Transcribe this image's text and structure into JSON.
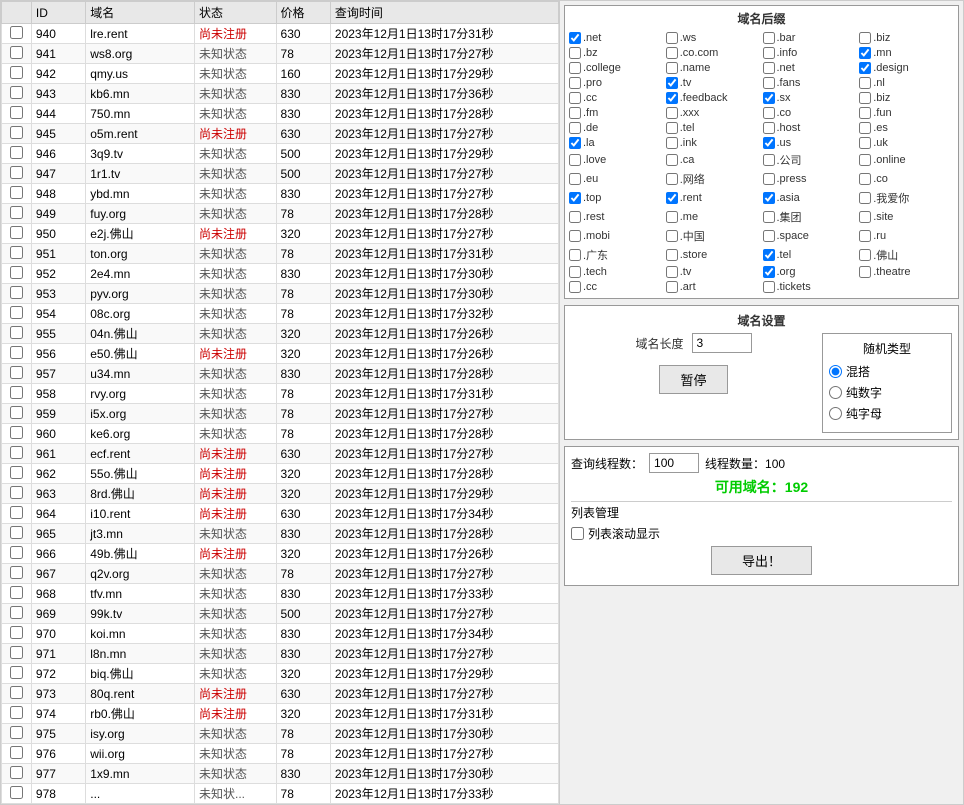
{
  "table": {
    "headers": [
      "",
      "ID",
      "域名",
      "状态",
      "价格",
      "查询时间"
    ],
    "rows": [
      {
        "id": "940",
        "domain": "lre.rent",
        "status": "尚未注册",
        "price": "630",
        "time": "2023年12月1日13时17分31秒"
      },
      {
        "id": "941",
        "domain": "ws8.org",
        "status": "未知状态",
        "price": "78",
        "time": "2023年12月1日13时17分27秒"
      },
      {
        "id": "942",
        "domain": "qmy.us",
        "status": "未知状态",
        "price": "160",
        "time": "2023年12月1日13时17分29秒"
      },
      {
        "id": "943",
        "domain": "kb6.mn",
        "status": "未知状态",
        "price": "830",
        "time": "2023年12月1日13时17分36秒"
      },
      {
        "id": "944",
        "domain": "750.mn",
        "status": "未知状态",
        "price": "830",
        "time": "2023年12月1日13时17分28秒"
      },
      {
        "id": "945",
        "domain": "o5m.rent",
        "status": "尚未注册",
        "price": "630",
        "time": "2023年12月1日13时17分27秒"
      },
      {
        "id": "946",
        "domain": "3q9.tv",
        "status": "未知状态",
        "price": "500",
        "time": "2023年12月1日13时17分29秒"
      },
      {
        "id": "947",
        "domain": "1r1.tv",
        "status": "未知状态",
        "price": "500",
        "time": "2023年12月1日13时17分27秒"
      },
      {
        "id": "948",
        "domain": "ybd.mn",
        "status": "未知状态",
        "price": "830",
        "time": "2023年12月1日13时17分27秒"
      },
      {
        "id": "949",
        "domain": "fuy.org",
        "status": "未知状态",
        "price": "78",
        "time": "2023年12月1日13时17分28秒"
      },
      {
        "id": "950",
        "domain": "e2j.佛山",
        "status": "尚未注册",
        "price": "320",
        "time": "2023年12月1日13时17分27秒"
      },
      {
        "id": "951",
        "domain": "ton.org",
        "status": "未知状态",
        "price": "78",
        "time": "2023年12月1日13时17分31秒"
      },
      {
        "id": "952",
        "domain": "2e4.mn",
        "status": "未知状态",
        "price": "830",
        "time": "2023年12月1日13时17分30秒"
      },
      {
        "id": "953",
        "domain": "pyv.org",
        "status": "未知状态",
        "price": "78",
        "time": "2023年12月1日13时17分30秒"
      },
      {
        "id": "954",
        "domain": "08c.org",
        "status": "未知状态",
        "price": "78",
        "time": "2023年12月1日13时17分32秒"
      },
      {
        "id": "955",
        "domain": "04n.佛山",
        "status": "未知状态",
        "price": "320",
        "time": "2023年12月1日13时17分26秒"
      },
      {
        "id": "956",
        "domain": "e50.佛山",
        "status": "尚未注册",
        "price": "320",
        "time": "2023年12月1日13时17分26秒"
      },
      {
        "id": "957",
        "domain": "u34.mn",
        "status": "未知状态",
        "price": "830",
        "time": "2023年12月1日13时17分28秒"
      },
      {
        "id": "958",
        "domain": "rvy.org",
        "status": "未知状态",
        "price": "78",
        "time": "2023年12月1日13时17分31秒"
      },
      {
        "id": "959",
        "domain": "i5x.org",
        "status": "未知状态",
        "price": "78",
        "time": "2023年12月1日13时17分27秒"
      },
      {
        "id": "960",
        "domain": "ke6.org",
        "status": "未知状态",
        "price": "78",
        "time": "2023年12月1日13时17分28秒"
      },
      {
        "id": "961",
        "domain": "ecf.rent",
        "status": "尚未注册",
        "price": "630",
        "time": "2023年12月1日13时17分27秒"
      },
      {
        "id": "962",
        "domain": "55o.佛山",
        "status": "尚未注册",
        "price": "320",
        "time": "2023年12月1日13时17分28秒"
      },
      {
        "id": "963",
        "domain": "8rd.佛山",
        "status": "尚未注册",
        "price": "320",
        "time": "2023年12月1日13时17分29秒"
      },
      {
        "id": "964",
        "domain": "i10.rent",
        "status": "尚未注册",
        "price": "630",
        "time": "2023年12月1日13时17分34秒"
      },
      {
        "id": "965",
        "domain": "jt3.mn",
        "status": "未知状态",
        "price": "830",
        "time": "2023年12月1日13时17分28秒"
      },
      {
        "id": "966",
        "domain": "49b.佛山",
        "status": "尚未注册",
        "price": "320",
        "time": "2023年12月1日13时17分26秒"
      },
      {
        "id": "967",
        "domain": "q2v.org",
        "status": "未知状态",
        "price": "78",
        "time": "2023年12月1日13时17分27秒"
      },
      {
        "id": "968",
        "domain": "tfv.mn",
        "status": "未知状态",
        "price": "830",
        "time": "2023年12月1日13时17分33秒"
      },
      {
        "id": "969",
        "domain": "99k.tv",
        "status": "未知状态",
        "price": "500",
        "time": "2023年12月1日13时17分27秒"
      },
      {
        "id": "970",
        "domain": "koi.mn",
        "status": "未知状态",
        "price": "830",
        "time": "2023年12月1日13时17分34秒"
      },
      {
        "id": "971",
        "domain": "l8n.mn",
        "status": "未知状态",
        "price": "830",
        "time": "2023年12月1日13时17分27秒"
      },
      {
        "id": "972",
        "domain": "biq.佛山",
        "status": "未知状态",
        "price": "320",
        "time": "2023年12月1日13时17分29秒"
      },
      {
        "id": "973",
        "domain": "80q.rent",
        "status": "尚未注册",
        "price": "630",
        "time": "2023年12月1日13时17分27秒"
      },
      {
        "id": "974",
        "domain": "rb0.佛山",
        "status": "尚未注册",
        "price": "320",
        "time": "2023年12月1日13时17分31秒"
      },
      {
        "id": "975",
        "domain": "isy.org",
        "status": "未知状态",
        "price": "78",
        "time": "2023年12月1日13时17分30秒"
      },
      {
        "id": "976",
        "domain": "wii.org",
        "status": "未知状态",
        "price": "78",
        "time": "2023年12月1日13时17分27秒"
      },
      {
        "id": "977",
        "domain": "1x9.mn",
        "status": "未知状态",
        "price": "830",
        "time": "2023年12月1日13时17分30秒"
      },
      {
        "id": "978",
        "domain": "...",
        "status": "未知状...",
        "price": "78",
        "time": "2023年12月1日13时17分33秒"
      }
    ]
  },
  "suffixes": {
    "title": "域名后缀",
    "col1": [
      {
        "label": ".net",
        "checked": true
      },
      {
        "label": ".biz",
        "checked": false
      },
      {
        "label": ".info",
        "checked": false
      },
      {
        "label": ".name",
        "checked": false
      },
      {
        "label": ".pro",
        "checked": false
      },
      {
        "label": ".nl",
        "checked": false
      },
      {
        "label": ".sx",
        "checked": true
      },
      {
        "label": ".xxx",
        "checked": false
      },
      {
        "label": ".de",
        "checked": false
      },
      {
        "label": ".es",
        "checked": false
      },
      {
        "label": ".us",
        "checked": true
      },
      {
        "label": ".ca",
        "checked": false
      },
      {
        "label": ".eu",
        "checked": false
      },
      {
        "label": ".co",
        "checked": false
      },
      {
        "label": ".asia",
        "checked": true
      },
      {
        "label": ".me",
        "checked": false
      },
      {
        "label": ".mobi",
        "checked": false
      },
      {
        "label": ".ru",
        "checked": false
      },
      {
        "label": ".tel",
        "checked": true
      },
      {
        "label": ".tv",
        "checked": false
      },
      {
        "label": ".cc",
        "checked": false
      }
    ],
    "col2": [
      {
        "label": ".ws",
        "checked": false
      },
      {
        "label": ".bz",
        "checked": false
      },
      {
        "label": ".mn",
        "checked": true
      },
      {
        "label": ".net",
        "checked": false
      },
      {
        "label": ".tv",
        "checked": true
      },
      {
        "label": ".cc",
        "checked": false
      },
      {
        "label": ".biz",
        "checked": false
      },
      {
        "label": ".co",
        "checked": false
      },
      {
        "label": ".tel",
        "checked": false
      },
      {
        "label": ".la",
        "checked": true
      },
      {
        "label": ".uk",
        "checked": false
      },
      {
        "label": ".公司",
        "checked": false
      },
      {
        "label": ".网络",
        "checked": false
      },
      {
        "label": ".top",
        "checked": true
      },
      {
        "label": ".我爱你",
        "checked": false
      },
      {
        "label": ".集团",
        "checked": false
      },
      {
        "label": ".中国",
        "checked": false
      },
      {
        "label": ".广东",
        "checked": false
      },
      {
        "label": ".佛山",
        "checked": false
      },
      {
        "label": ".org",
        "checked": true
      },
      {
        "label": ".art",
        "checked": false
      }
    ],
    "col3": [
      {
        "label": ".bar",
        "checked": false
      },
      {
        "label": ".co.com",
        "checked": false
      },
      {
        "label": ".college",
        "checked": false
      },
      {
        "label": ".design",
        "checked": true
      },
      {
        "label": ".fans",
        "checked": false
      },
      {
        "label": ".feedback",
        "checked": true
      },
      {
        "label": ".fm",
        "checked": false
      },
      {
        "label": ".fun",
        "checked": false
      },
      {
        "label": ".host",
        "checked": false
      },
      {
        "label": ".ink",
        "checked": false
      },
      {
        "label": ".love",
        "checked": false
      },
      {
        "label": ".online",
        "checked": false
      },
      {
        "label": ".press",
        "checked": false
      },
      {
        "label": ".rent",
        "checked": true
      },
      {
        "label": ".rest",
        "checked": false
      },
      {
        "label": ".site",
        "checked": false
      },
      {
        "label": ".space",
        "checked": false
      },
      {
        "label": ".store",
        "checked": false
      },
      {
        "label": ".tech",
        "checked": false
      },
      {
        "label": ".theatre",
        "checked": false
      },
      {
        "label": ".tickets",
        "checked": false
      }
    ]
  },
  "domain_settings": {
    "title": "域名设置",
    "length_label": "域名长度",
    "length_value": "3",
    "random_type_title": "随机类型",
    "radio_options": [
      "混搭",
      "纯数字",
      "纯字母"
    ],
    "selected_radio": "混搭",
    "pause_btn": "暂停"
  },
  "bottom": {
    "query_threads_label": "查询线程数：",
    "query_threads_value": "100",
    "thread_count_label": "线程数量：100",
    "available_label": "可用域名：192",
    "list_mgmt_label": "列表管理",
    "scroll_checkbox_label": "列表滚动显示",
    "export_btn": "导出！"
  }
}
